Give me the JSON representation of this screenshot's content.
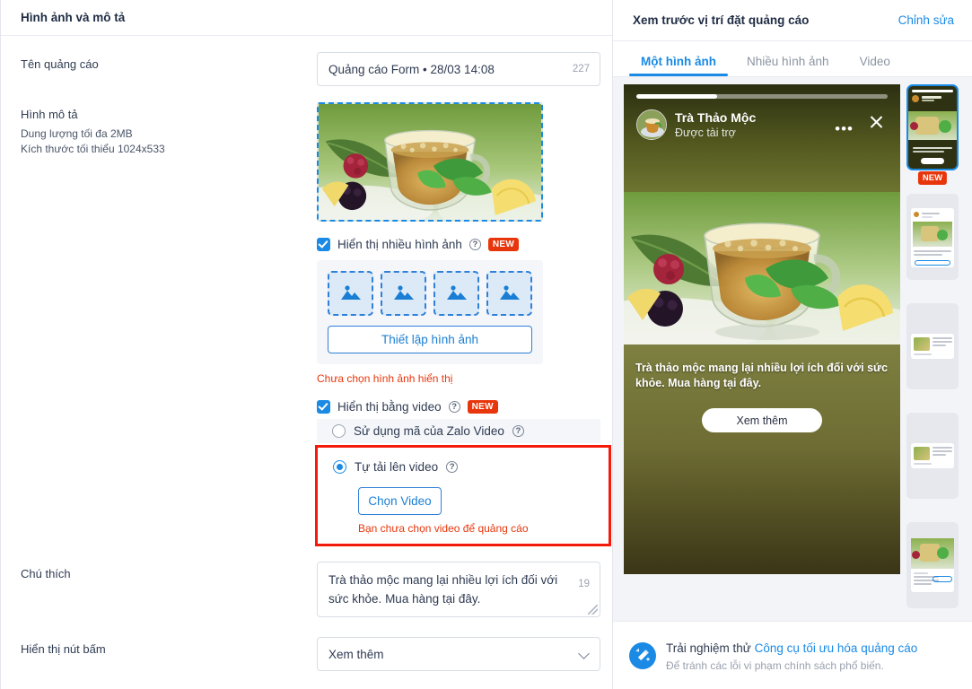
{
  "left": {
    "header_title": "Hình ảnh và mô tả",
    "ad_name": {
      "label": "Tên quảng cáo",
      "value": "Quảng cáo Form • 28/03 14:08",
      "counter": "227"
    },
    "image_section": {
      "label": "Hình mô tả",
      "hint_size": "Dung lượng tối đa 2MB",
      "hint_dim": "Kích thước tối thiểu 1024x533"
    },
    "multi_image": {
      "checkbox_label": "Hiển thị nhiều hình ảnh",
      "badge": "NEW",
      "help_icon": "question-mark-icon",
      "slot_icon": "image-placeholder-icon",
      "slots": [
        "slot-1",
        "slot-2",
        "slot-3",
        "slot-4"
      ],
      "setup_button": "Thiết lập hình ảnh",
      "error": "Chưa chọn hình ảnh hiển thị"
    },
    "video": {
      "checkbox_label": "Hiển thị bằng video",
      "badge": "NEW",
      "option_zalo": "Sử dụng mã của Zalo Video",
      "option_upload": "Tự tải lên video",
      "choose_button": "Chọn Video",
      "error": "Bạn chưa chọn video để quảng cáo"
    },
    "caption": {
      "label": "Chú thích",
      "value": "Trà thảo mộc mang lại nhiều lợi ích đối với sức khỏe. Mua hàng tại đây.",
      "counter": "19"
    },
    "cta": {
      "label": "Hiển thị nút bấm",
      "value": "Xem thêm"
    }
  },
  "right": {
    "header_title": "Xem trước vị trí đặt quảng cáo",
    "edit_link": "Chỉnh sửa",
    "tabs": [
      {
        "label": "Một hình ảnh",
        "active": true
      },
      {
        "label": "Nhiều hình ảnh",
        "active": false
      },
      {
        "label": "Video",
        "active": false
      }
    ],
    "preview": {
      "brand_name": "Trà Thảo Mộc",
      "sponsored": "Được tài trợ",
      "more_icon": "ellipsis-icon",
      "close_icon": "close-icon",
      "caption": "Trà thảo mộc mang lại nhiều lợi ích đối với sức khỏe. Mua hàng tại đây.",
      "cta_button": "Xem thêm"
    },
    "rail": {
      "badge": "NEW",
      "items": [
        "thumbnail-1",
        "thumbnail-2",
        "thumbnail-3",
        "thumbnail-4",
        "thumbnail-5"
      ]
    },
    "footer": {
      "icon": "magic-wand-icon",
      "lead": "Trải nghiệm thử ",
      "link": "Công cụ tối ưu hóa quảng cáo",
      "sub": "Để tránh các lỗi vi phạm chính sách phổ biến."
    }
  },
  "colors": {
    "accent_blue": "#1a8ae5",
    "error_red": "#e8360c",
    "highlight_red": "#f51b0c",
    "text": "#2f3b52"
  }
}
